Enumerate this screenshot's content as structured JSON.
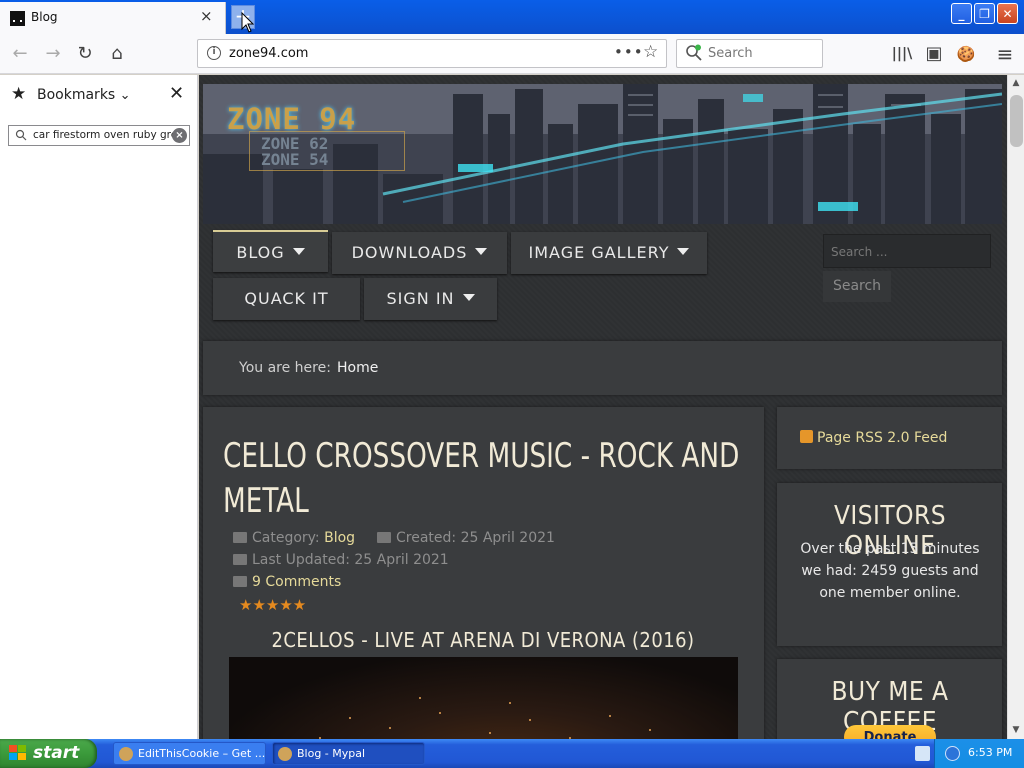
{
  "browser": {
    "tab": {
      "title": "Blog",
      "close": "×"
    },
    "new_tab": "+",
    "window_buttons": {
      "minimize": "_",
      "maximize": "❐",
      "close": "✕"
    },
    "nav": {
      "back": "←",
      "forward": "→",
      "reload": "↻",
      "home": "⌂"
    },
    "url": "zone94.com",
    "url_actions": {
      "more": "•••",
      "bookmark": "☆"
    },
    "search_placeholder": "Search",
    "toolbar_icons": {
      "library": "|||\\",
      "sidebar": "▣",
      "cookie": "🍪",
      "menu": "≡"
    }
  },
  "sidebar": {
    "title": "Bookmarks",
    "chevron": "⌄",
    "close": "✕",
    "search_value": "car firestorm oven ruby greyl",
    "clear": "×"
  },
  "site": {
    "logo": "ZONE 94",
    "logo_sub": [
      "ZONE 62",
      "ZONE 54"
    ],
    "menu": [
      {
        "label": "BLOG"
      },
      {
        "label": "DOWNLOADS"
      },
      {
        "label": "IMAGE GALLERY"
      },
      {
        "label": "QUACK IT"
      },
      {
        "label": "SIGN IN"
      }
    ],
    "search_placeholder": "Search ...",
    "search_button": "Search",
    "breadcrumb": {
      "label": "You are here:",
      "home": "Home"
    },
    "article": {
      "title": "CELLO CROSSOVER MUSIC - ROCK AND METAL",
      "category_label": "Category:",
      "category": "Blog",
      "created": "Created: 25 April 2021",
      "updated": "Last Updated: 25 April 2021",
      "comments": "9 Comments",
      "rating": 5,
      "stars": "★★★★★",
      "subheading": "2CELLOS - LIVE AT ARENA DI VERONA (2016)"
    },
    "rss": "Page RSS 2.0 Feed",
    "visitors": {
      "title": "VISITORS ONLINE",
      "text": "Over the past 15 minutes we had: 2459 guests and one member online."
    },
    "coffee": {
      "title": "BUY ME A COFFEE",
      "donate": "Donate"
    }
  },
  "taskbar": {
    "start": "start",
    "tasks": [
      {
        "label": "EditThisCookie – Get ..."
      },
      {
        "label": "Blog - Mypal"
      }
    ],
    "clock": "6:53 PM"
  }
}
